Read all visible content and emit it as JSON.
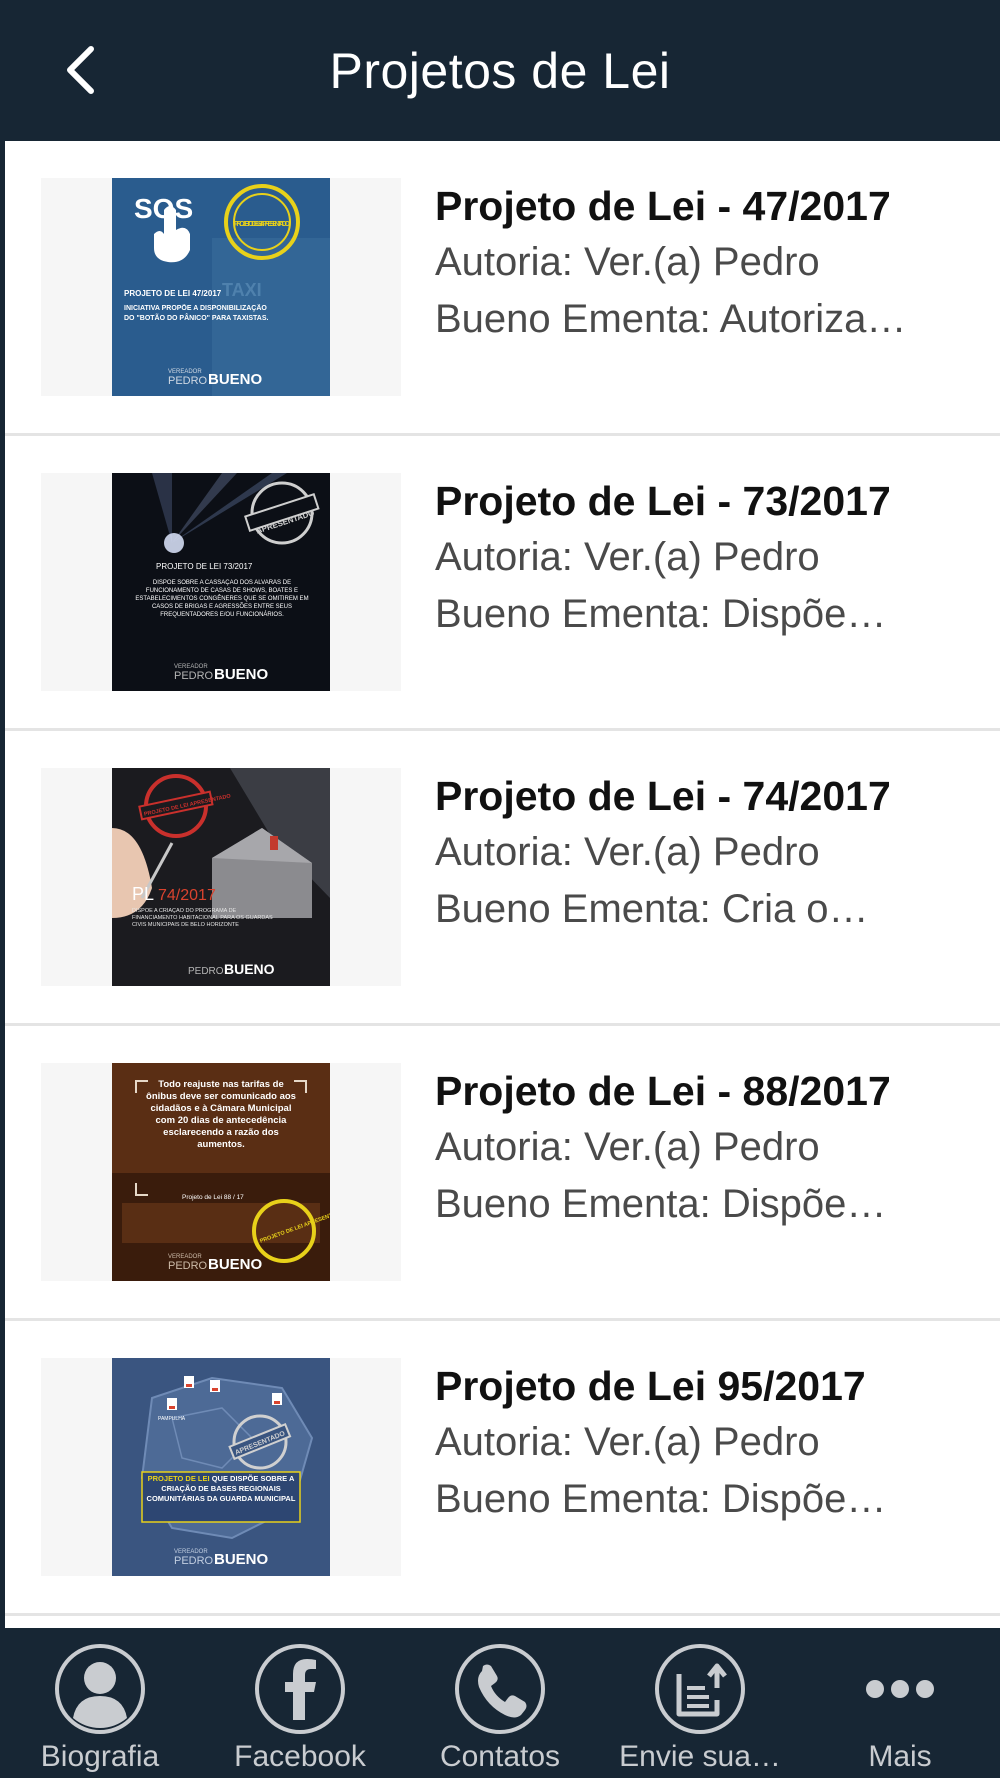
{
  "header": {
    "title": "Projetos de Lei"
  },
  "items": [
    {
      "title": "Projeto de Lei - 47/2017",
      "desc_line1": "Autoria: Ver.(a) Pedro",
      "desc_line2": "Bueno Ementa: Autoriza…",
      "thumb": {
        "top": "SOS",
        "caption": "PROJETO DE LEI 47/2017",
        "body": "INICIATIVA PROPÕE A DISPONIBILIZAÇÃO DO \"BOTÃO DO PÂNICO\" PARA TAXISTAS.",
        "stamp": "PROJETO DE LEI APRESENTADO",
        "tag": "TAXI",
        "brand_small": "VEREADOR",
        "brand_a": "PEDRO",
        "brand_b": "BUENO"
      }
    },
    {
      "title": "Projeto de Lei - 73/2017",
      "desc_line1": "Autoria: Ver.(a) Pedro",
      "desc_line2": "Bueno Ementa: Dispõe…",
      "thumb": {
        "caption": "PROJETO DE LEI 73/2017",
        "body": "DISPÕE SOBRE A CASSAÇÃO DOS ALVARÁS DE FUNCIONAMENTO DE CASAS DE SHOWS, BOATES E ESTABELECIMENTOS CONGÊNERES QUE SE OMITIREM EM CASOS DE BRIGAS E AGRESSÕES ENTRE SEUS FREQUENTADORES E/OU FUNCIONÁRIOS.",
        "stamp": "APRESENTADO",
        "brand_small": "VEREADOR",
        "brand_a": "PEDRO",
        "brand_b": "BUENO"
      }
    },
    {
      "title": "Projeto de Lei - 74/2017",
      "desc_line1": "Autoria: Ver.(a) Pedro",
      "desc_line2": "Bueno Ementa: Cria o…",
      "thumb": {
        "caption_a": "PL",
        "caption_b": "74/2017",
        "body": "DISPÕE A CRIAÇÃO DO PROGRAMA DE FINANCIAMENTO HABITACIONAL PARA OS GUARDAS CIVIS MUNICIPAIS DE BELO HORIZONTE",
        "stamp": "PROJETO DE LEI APRESENTADO",
        "brand_a": "PEDRO",
        "brand_b": "BUENO"
      }
    },
    {
      "title": "Projeto de Lei - 88/2017",
      "desc_line1": "Autoria: Ver.(a) Pedro",
      "desc_line2": "Bueno Ementa: Dispõe…",
      "thumb": {
        "line1": "Todo reajuste nas tarifas de ônibus deve ser comunicado aos cidadãos e à Câmara Municipal com 20 dias de antecedência esclarecendo a razão dos aumentos.",
        "caption": "Projeto de Lei 88 / 17",
        "stamp": "PROJETO DE LEI APRESENTADO",
        "brand_small": "VEREADOR",
        "brand_a": "PEDRO",
        "brand_b": "BUENO"
      }
    },
    {
      "title": "Projeto de Lei 95/2017",
      "desc_line1": "Autoria: Ver.(a) Pedro",
      "desc_line2": "Bueno Ementa: Dispõe…",
      "thumb": {
        "body_a": "PROJETO DE LEI",
        "body_b": "QUE DISPÕE SOBRE A CRIAÇÃO DE BASES REGIONAIS COMUNITÁRIAS DA GUARDA MUNICIPAL",
        "stamp": "APRESENTADO",
        "region": "PAMPULHA",
        "brand_small": "VEREADOR",
        "brand_a": "PEDRO",
        "brand_b": "BUENO"
      }
    }
  ],
  "tabs": [
    {
      "label": "Biografia",
      "icon": "person-icon"
    },
    {
      "label": "Facebook",
      "icon": "facebook-icon"
    },
    {
      "label": "Contatos",
      "icon": "phone-icon"
    },
    {
      "label": "Envie sua…",
      "icon": "upload-icon"
    },
    {
      "label": "Mais",
      "icon": "more-icon"
    }
  ],
  "colors": {
    "header_bg": "#172634",
    "tabbar_bg": "#172634",
    "tab_fg": "#c9ccd0",
    "divider": "#e4e4e4",
    "accent_yellow": "#e8d11a"
  }
}
